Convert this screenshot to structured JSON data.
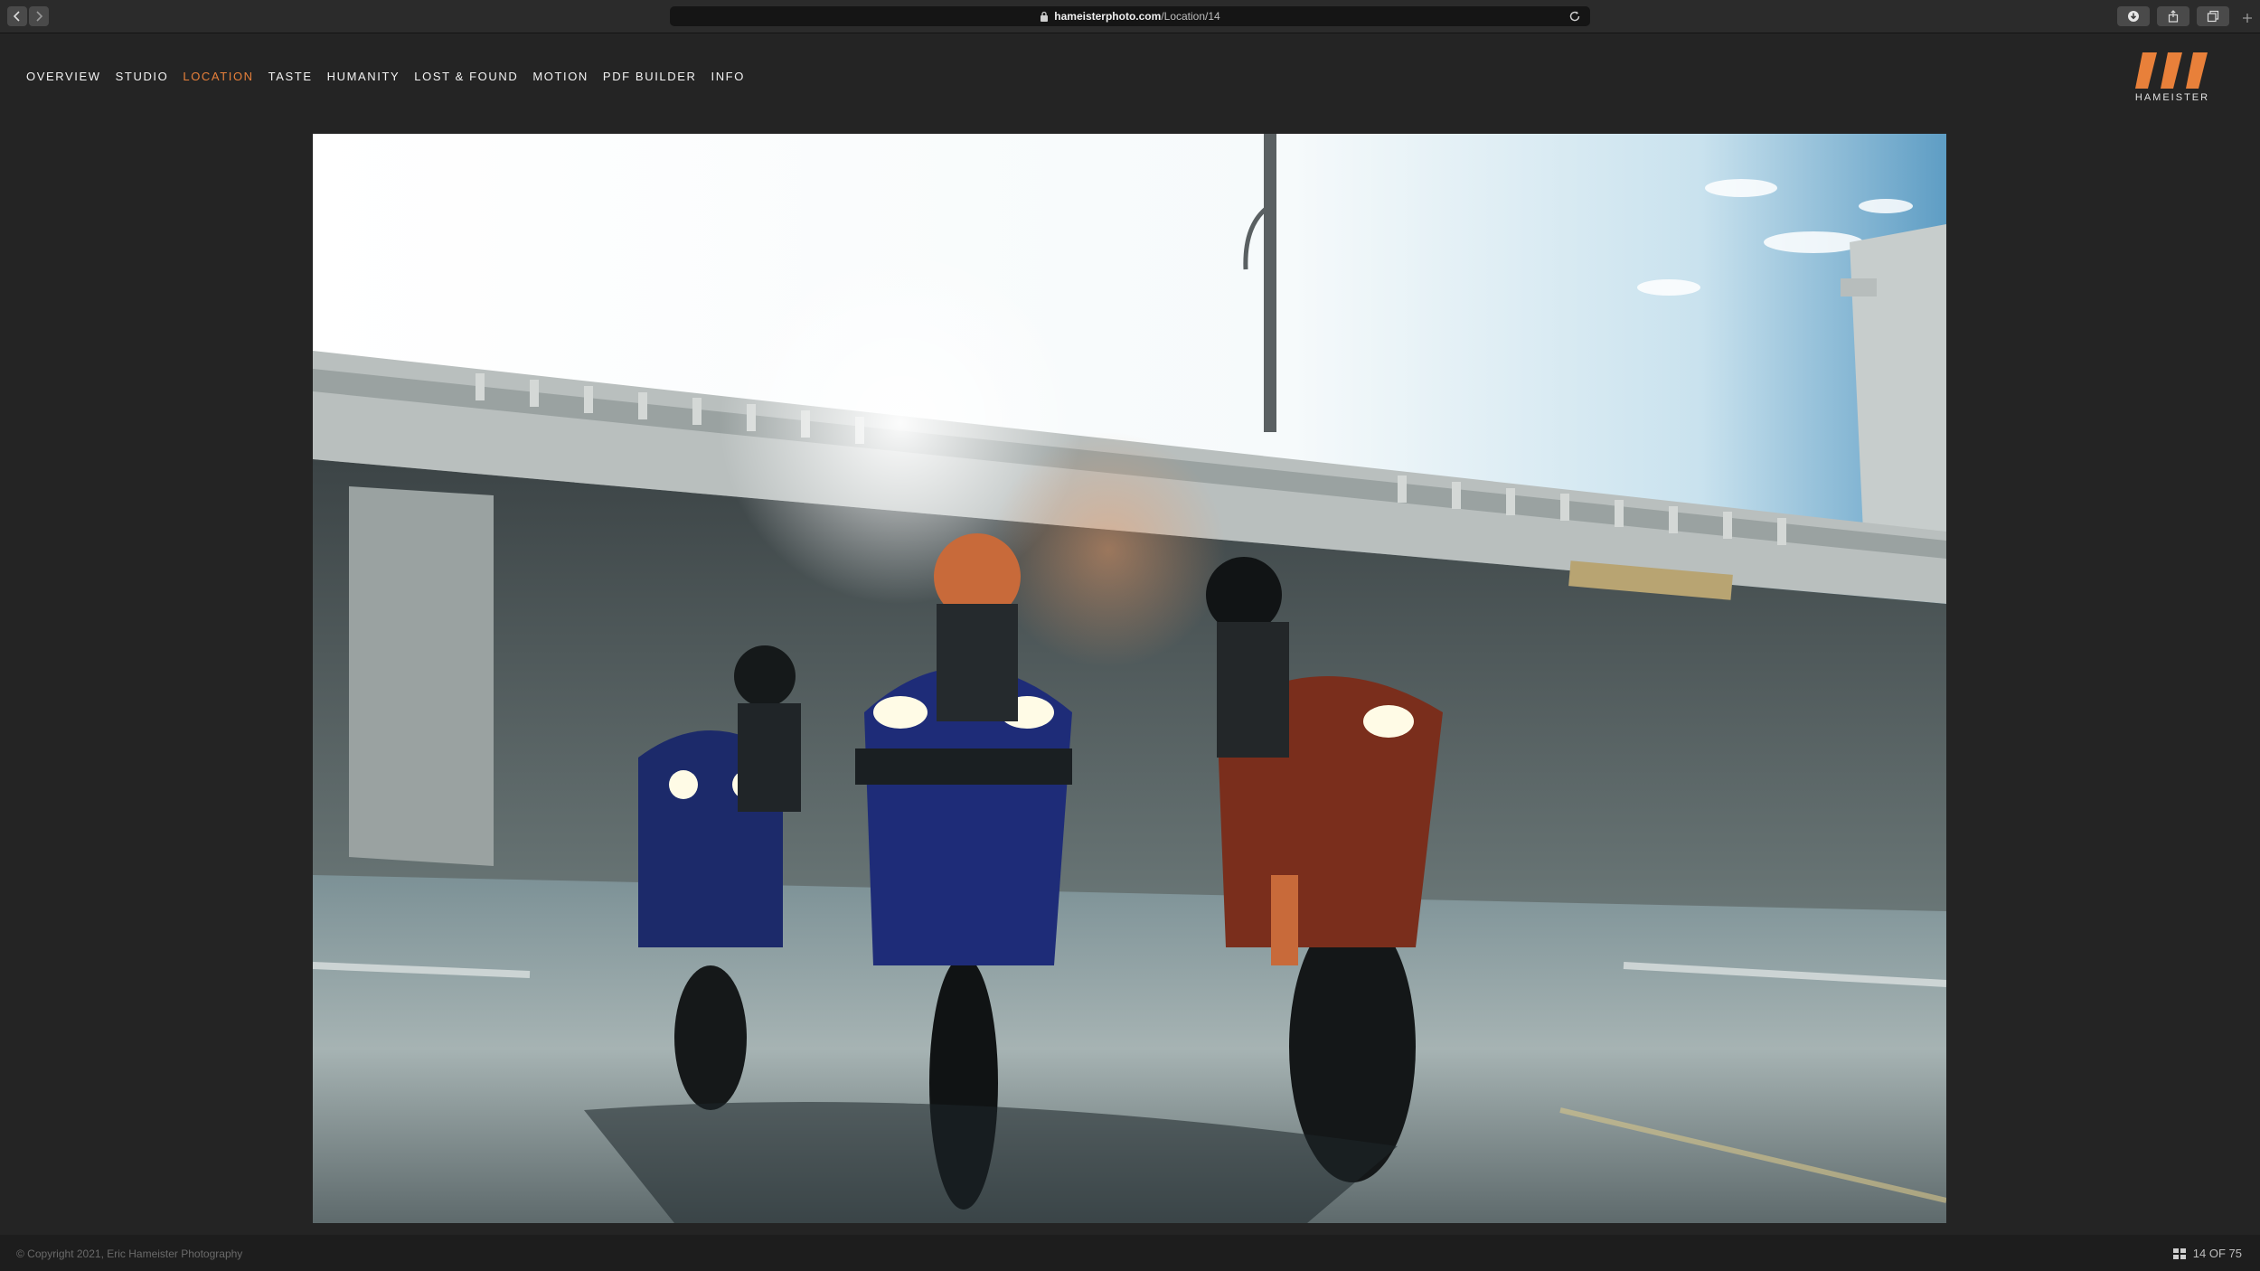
{
  "browser": {
    "url_host": "hameisterphoto.com",
    "url_path": "/Location/14",
    "icons": [
      "back-icon",
      "forward-icon",
      "lock-icon",
      "reload-icon",
      "download-icon",
      "share-icon",
      "tabs-icon",
      "new-tab-icon"
    ]
  },
  "nav": {
    "items": [
      {
        "label": "OVERVIEW",
        "active": false
      },
      {
        "label": "STUDIO",
        "active": false
      },
      {
        "label": "LOCATION",
        "active": true
      },
      {
        "label": "TASTE",
        "active": false
      },
      {
        "label": "HUMANITY",
        "active": false
      },
      {
        "label": "LOST & FOUND",
        "active": false
      },
      {
        "label": "MOTION",
        "active": false
      },
      {
        "label": "PDF BUILDER",
        "active": false
      },
      {
        "label": "INFO",
        "active": false
      }
    ]
  },
  "logo": {
    "wordmark": "HAMEISTER",
    "color": "#e8803a"
  },
  "footer": {
    "copyright": "© Copyright 2021, Eric Hameister Photography",
    "counter": "14 OF 75"
  },
  "colors": {
    "accent": "#e8803a",
    "background": "#242424",
    "footer": "#1d1d1d"
  }
}
